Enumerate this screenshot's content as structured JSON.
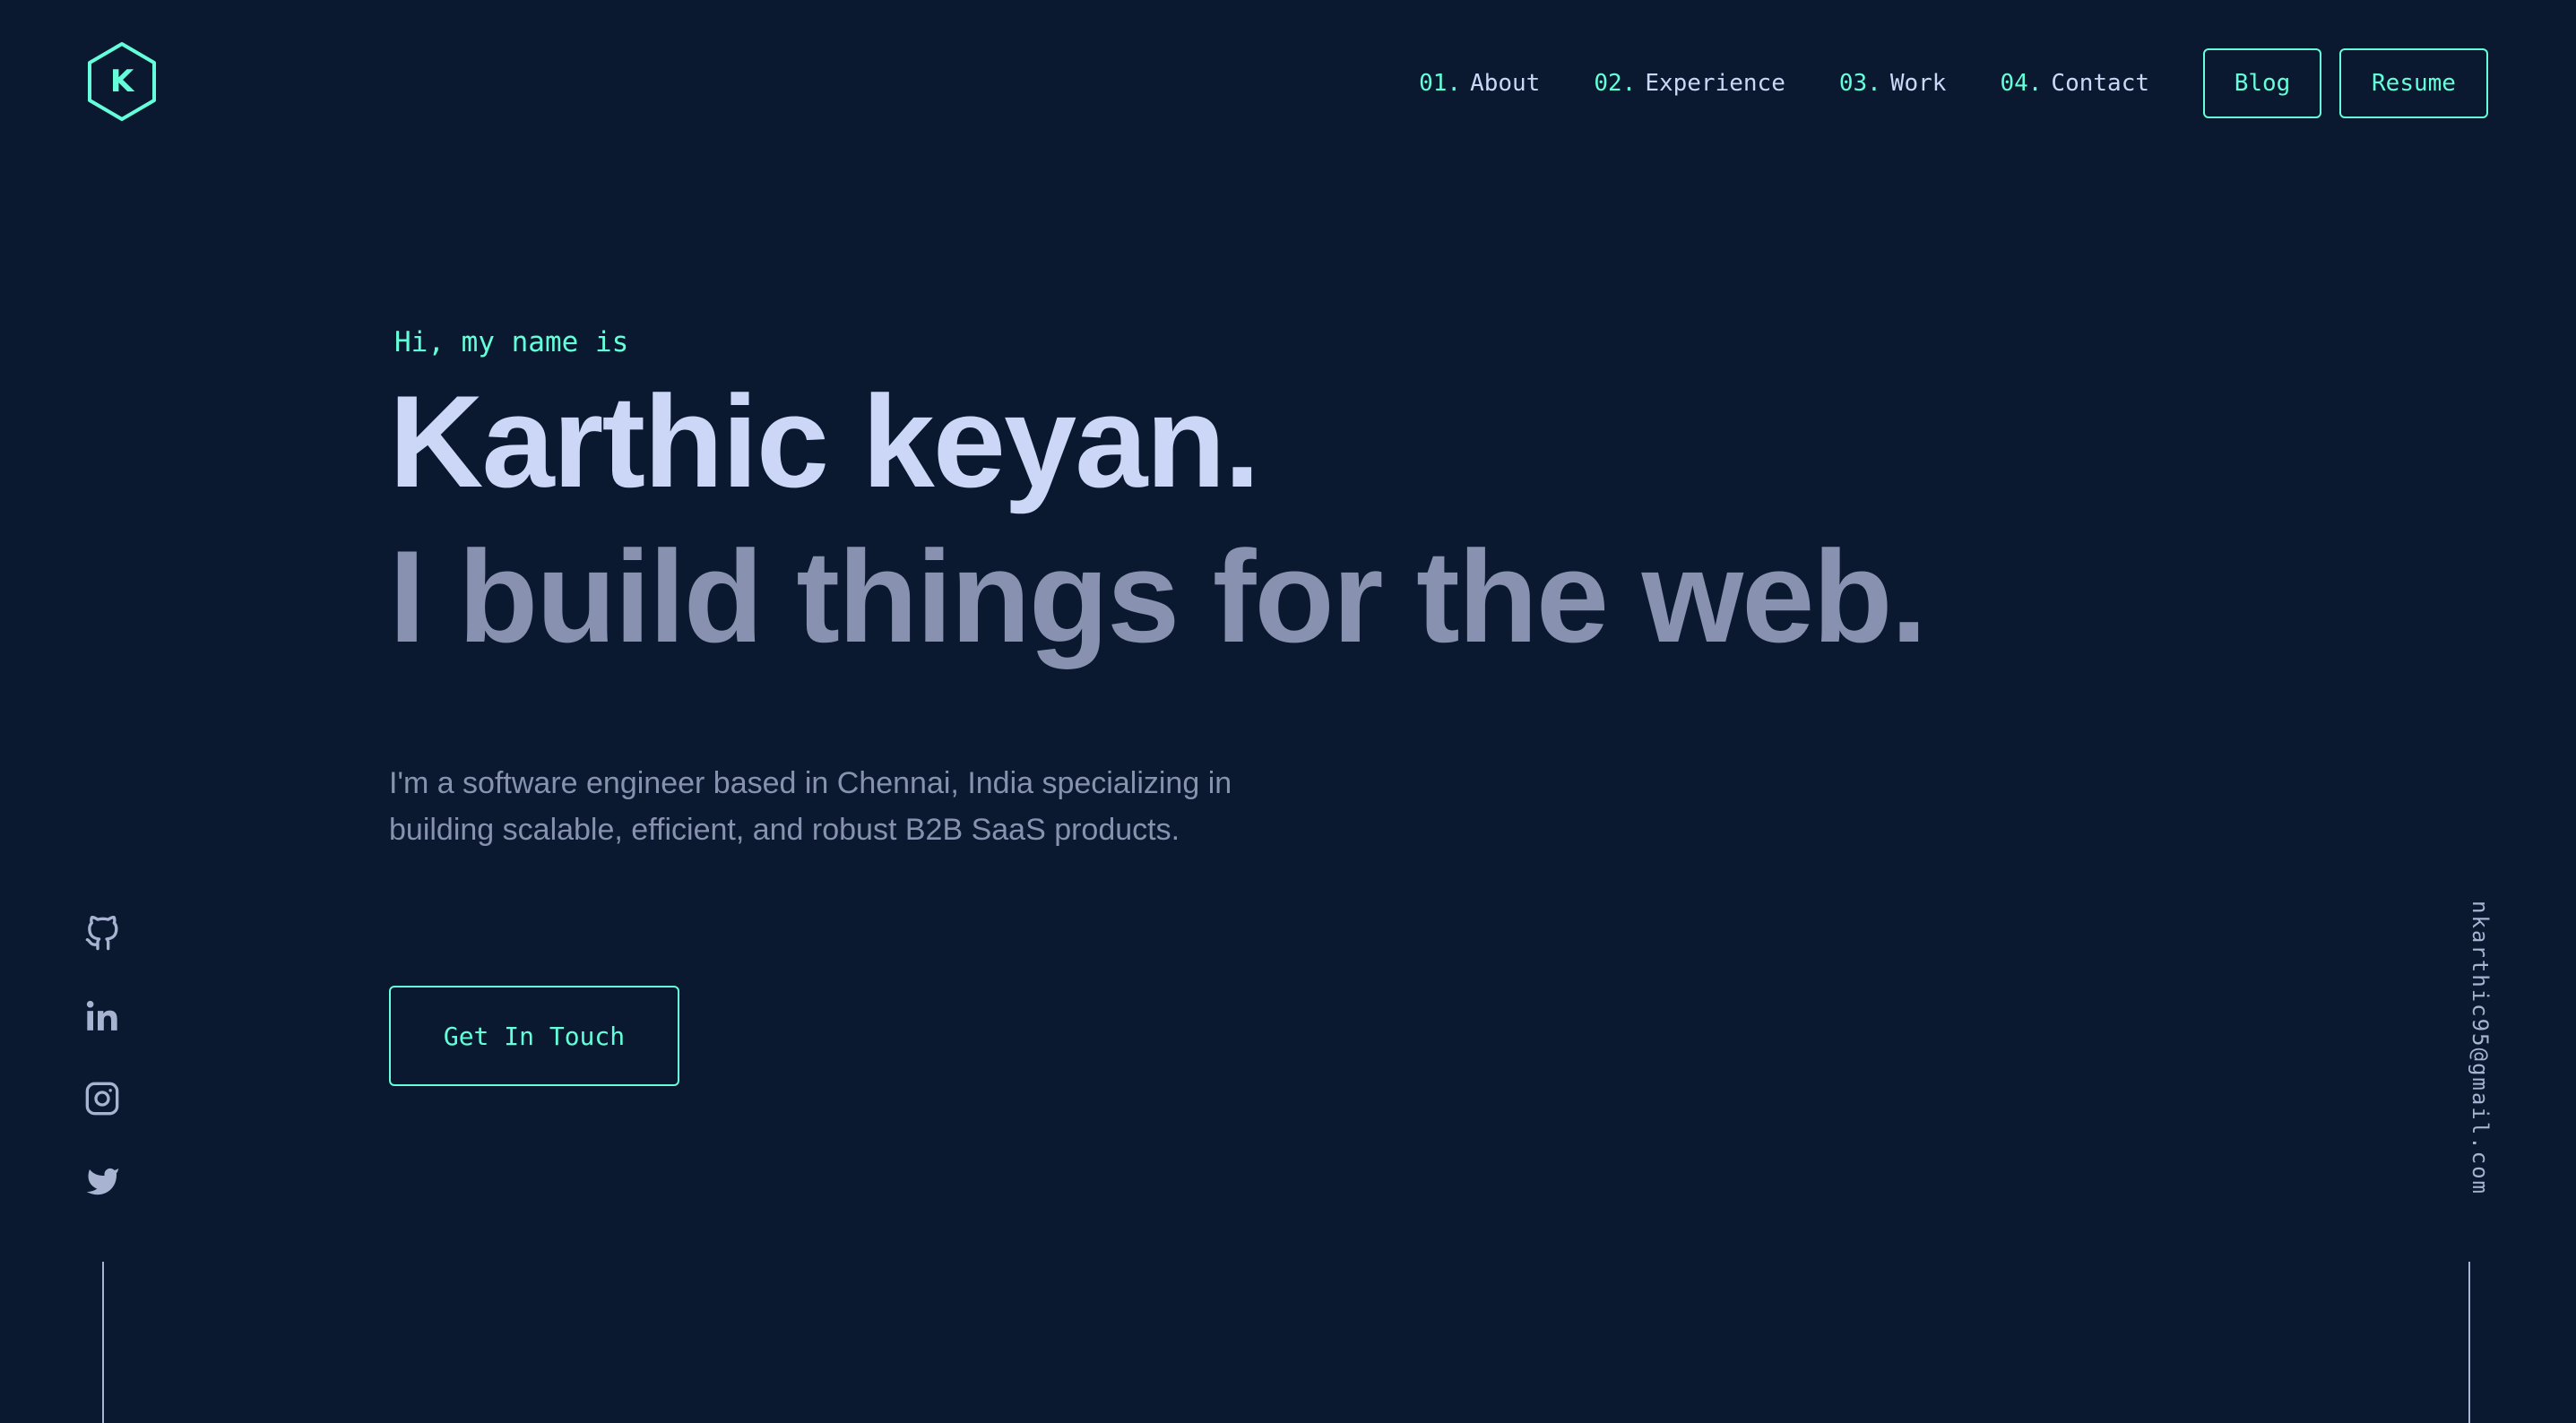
{
  "logo": {
    "letter": "K",
    "icon": "hexagon-logo-icon"
  },
  "nav": {
    "items": [
      {
        "num": "01.",
        "label": "About"
      },
      {
        "num": "02.",
        "label": "Experience"
      },
      {
        "num": "03.",
        "label": "Work"
      },
      {
        "num": "04.",
        "label": "Contact"
      }
    ],
    "blog_label": "Blog",
    "resume_label": "Resume"
  },
  "hero": {
    "greeting": "Hi, my name is",
    "name": "Karthic keyan.",
    "tagline": "I build things for the web.",
    "description": "I'm a software engineer based in Chennai, India specializing in building scalable, efficient, and robust B2B SaaS products.",
    "cta_label": "Get In Touch"
  },
  "social": {
    "icons": [
      "github-icon",
      "linkedin-icon",
      "instagram-icon",
      "twitter-icon"
    ]
  },
  "email": "nkarthic95@gmail.com",
  "colors": {
    "background": "#0a192f",
    "accent": "#64ffda",
    "heading": "#ccd6f6",
    "text": "#8892b0"
  }
}
